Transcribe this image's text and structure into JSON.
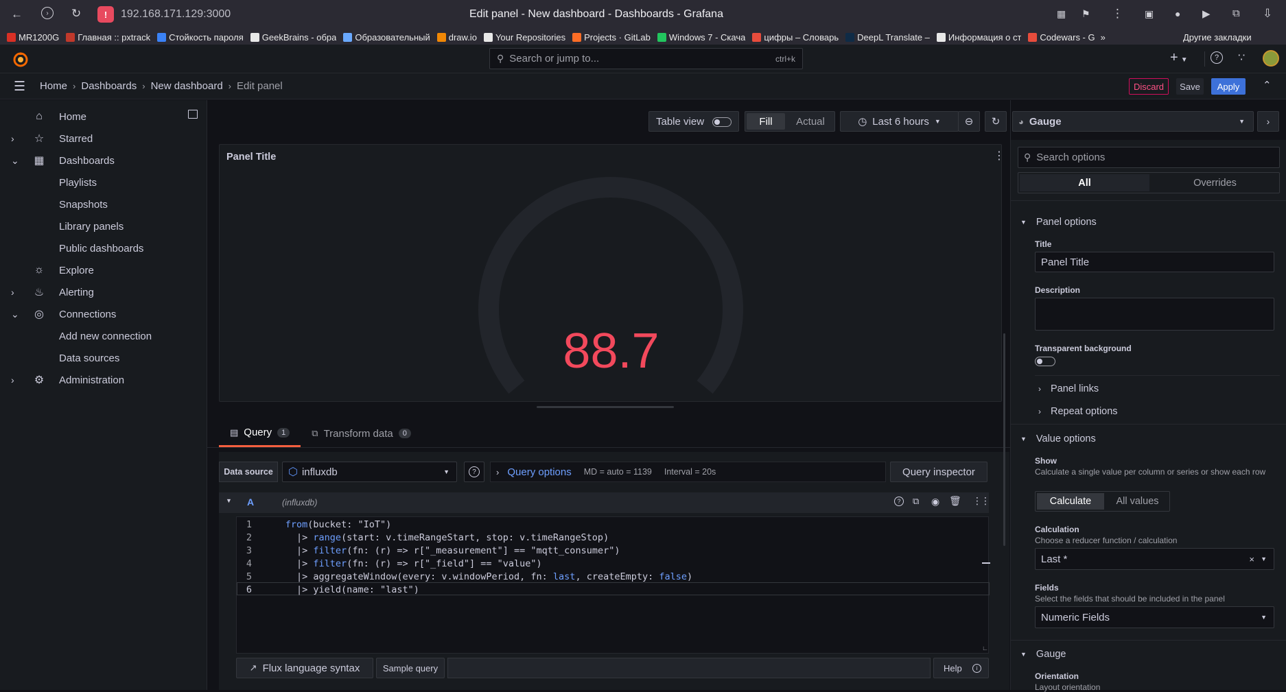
{
  "browser": {
    "url": "192.168.171.129:3000",
    "window_title": "Edit panel - New dashboard - Dashboards - Grafana",
    "bookmarks": [
      {
        "label": "MR1200G",
        "color": "#d93025"
      },
      {
        "label": "Главная :: pxtrack",
        "color": "#c0392b"
      },
      {
        "label": "Стойкость пароля",
        "color": "#3b82f6"
      },
      {
        "label": "GeekBrains - обра",
        "color": "#e8e8e8"
      },
      {
        "label": "Образовательный",
        "color": "#6aa9ff"
      },
      {
        "label": "draw.io",
        "color": "#f08705"
      },
      {
        "label": "Your Repositories",
        "color": "#e8e8e8"
      },
      {
        "label": "Projects · GitLab",
        "color": "#fc6d26"
      },
      {
        "label": "Windows 7 - Скача",
        "color": "#22c55e"
      },
      {
        "label": "цифры – Словарь",
        "color": "#e74c3c"
      },
      {
        "label": "DeepL Translate –",
        "color": "#0f2b46"
      },
      {
        "label": "Информация о ст",
        "color": "#e8e8e8"
      },
      {
        "label": "Codewars - G",
        "color": "#e74c3c"
      }
    ],
    "more_bookmarks": "»",
    "other_bookmarks": "Другие закладки"
  },
  "topnav": {
    "search_placeholder": "Search or jump to...",
    "shortcut": "ctrl+k",
    "plus": "+"
  },
  "breadcrumb": {
    "items": [
      "Home",
      "Dashboards",
      "New dashboard",
      "Edit panel"
    ],
    "discard": "Discard",
    "save": "Save",
    "apply": "Apply"
  },
  "sidebar": {
    "items": [
      {
        "label": "Home",
        "icon": "home-icon"
      },
      {
        "label": "Starred",
        "icon": "star-icon"
      },
      {
        "label": "Dashboards",
        "icon": "apps-icon"
      },
      {
        "label": "Playlists"
      },
      {
        "label": "Snapshots"
      },
      {
        "label": "Library panels"
      },
      {
        "label": "Public dashboards"
      },
      {
        "label": "Explore",
        "icon": "compass-icon"
      },
      {
        "label": "Alerting",
        "icon": "bell-icon"
      },
      {
        "label": "Connections",
        "icon": "connections-icon"
      },
      {
        "label": "Add new connection"
      },
      {
        "label": "Data sources"
      },
      {
        "label": "Administration",
        "icon": "gear-icon"
      }
    ]
  },
  "toolbar": {
    "table_view": "Table view",
    "fill": "Fill",
    "actual": "Actual",
    "time_range": "Last 6 hours"
  },
  "panel": {
    "title": "Panel Title",
    "value": "88.7",
    "value_color": "#f2495c"
  },
  "query_tabs": {
    "query_label": "Query",
    "query_count": "1",
    "transform_label": "Transform data",
    "transform_count": "0"
  },
  "datasource_row": {
    "label": "Data source",
    "datasource": "influxdb",
    "query_options": "Query options",
    "md": "MD = auto = 1139",
    "interval": "Interval = 20s",
    "inspector": "Query inspector"
  },
  "query": {
    "ref_id": "A",
    "ds_hint": "(influxdb)",
    "lines": [
      {
        "n": "1",
        "parts": [
          [
            "kw",
            "from"
          ],
          [
            "t",
            "(bucket: \"IoT\")"
          ]
        ]
      },
      {
        "n": "2",
        "parts": [
          [
            "t",
            "  |> "
          ],
          [
            "kw",
            "range"
          ],
          [
            "t",
            "(start: v.timeRangeStart, stop: v.timeRangeStop)"
          ]
        ]
      },
      {
        "n": "3",
        "parts": [
          [
            "t",
            "  |> "
          ],
          [
            "kw",
            "filter"
          ],
          [
            "t",
            "(fn: (r) => r[\"_measurement\"] == \"mqtt_consumer\")"
          ]
        ]
      },
      {
        "n": "4",
        "parts": [
          [
            "t",
            "  |> "
          ],
          [
            "kw",
            "filter"
          ],
          [
            "t",
            "(fn: (r) => r[\"_field\"] == \"value\")"
          ]
        ]
      },
      {
        "n": "5",
        "parts": [
          [
            "t",
            "  |> aggregateWindow(every: v.windowPeriod, fn: "
          ],
          [
            "kw",
            "last"
          ],
          [
            "t",
            ", createEmpty: "
          ],
          [
            "kw",
            "false"
          ],
          [
            "t",
            ")"
          ]
        ]
      },
      {
        "n": "6",
        "parts": [
          [
            "t",
            "  |> yield(name: \"last\")"
          ]
        ]
      }
    ],
    "flux_syntax": "Flux language syntax",
    "sample_query": "Sample query",
    "help": "Help"
  },
  "options": {
    "viz": "Gauge",
    "search_placeholder": "Search options",
    "tab_all": "All",
    "tab_overrides": "Overrides",
    "panel_options": "Panel options",
    "title_label": "Title",
    "title_value": "Panel Title",
    "description_label": "Description",
    "transparent_label": "Transparent background",
    "panel_links": "Panel links",
    "repeat_options": "Repeat options",
    "value_options": "Value options",
    "show_label": "Show",
    "show_desc": "Calculate a single value per column or series or show each row",
    "calculate": "Calculate",
    "all_values": "All values",
    "calculation_label": "Calculation",
    "calculation_desc": "Choose a reducer function / calculation",
    "calculation_value": "Last *",
    "fields_label": "Fields",
    "fields_desc": "Select the fields that should be included in the panel",
    "fields_value": "Numeric Fields",
    "gauge_section": "Gauge",
    "orientation_label": "Orientation",
    "orientation_desc": "Layout orientation"
  },
  "colors": {
    "accent": "#3d71d9",
    "gauge_track": "#22252b",
    "discard": "#d10e5c"
  }
}
